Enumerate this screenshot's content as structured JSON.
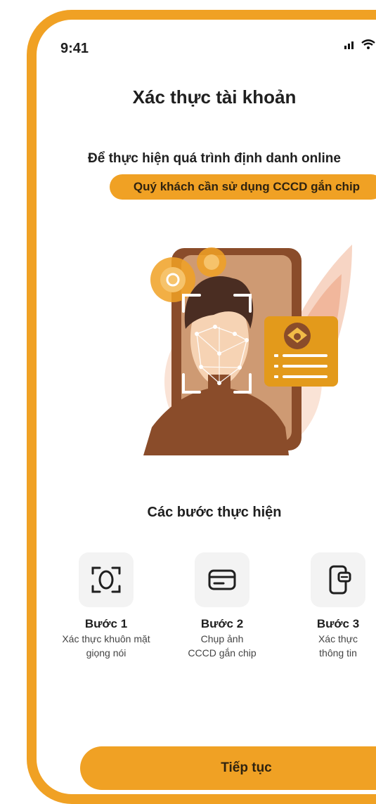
{
  "status_bar": {
    "time": "9:41"
  },
  "header": {
    "title": "Xác thực tài khoản",
    "close_icon": "close-icon"
  },
  "intro": {
    "line1": "Để thực hiện quá trình định danh online",
    "pill": "Quý khách cần sử dụng CCCD gắn chip"
  },
  "steps_section": {
    "title": "Các bước thực hiện",
    "steps": [
      {
        "title": "Bước 1",
        "desc1": "Xác thực khuôn mặt",
        "desc2": "giọng nói",
        "icon": "face-scan-icon"
      },
      {
        "title": "Bước 2",
        "desc1": "Chụp ảnh",
        "desc2": "CCCD gắn chip",
        "icon": "id-card-icon"
      },
      {
        "title": "Bước 3",
        "desc1": "Xác thực",
        "desc2": "thông tin",
        "icon": "phone-card-icon"
      }
    ]
  },
  "actions": {
    "continue_label": "Tiếp tục"
  },
  "colors": {
    "accent": "#f0a124",
    "brown": "#8a4c2a"
  }
}
